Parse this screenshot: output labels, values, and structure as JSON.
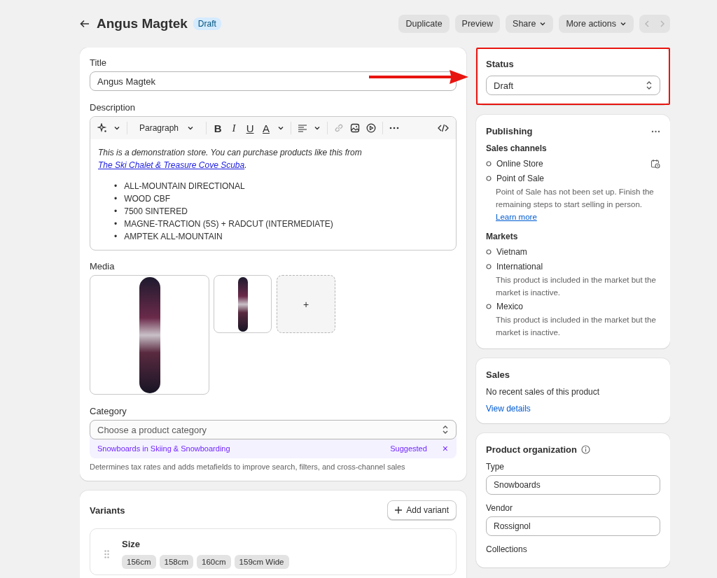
{
  "header": {
    "title": "Angus Magtek",
    "badge": "Draft",
    "actions": [
      {
        "label": "Duplicate",
        "dropdown": false
      },
      {
        "label": "Preview",
        "dropdown": false
      },
      {
        "label": "Share",
        "dropdown": true
      },
      {
        "label": "More actions",
        "dropdown": true
      }
    ],
    "pager": {
      "previous_disabled": true,
      "next_disabled": true
    }
  },
  "product": {
    "title_label": "Title",
    "title_value": "Angus Magtek",
    "description_label": "Description",
    "editor": {
      "block_style": "Paragraph",
      "format_buttons": [
        "B",
        "I",
        "U",
        "A"
      ]
    },
    "description": {
      "intro": "This is a demonstration store. You can purchase products like this from ",
      "link": "The Ski Chalet & Treasure Cove Scuba",
      "end": ".",
      "bullet": "•",
      "bullets": [
        "ALL-MOUNTAIN DIRECTIONAL",
        "WOOD CBF",
        "7500 SINTERED",
        "MAGNE-TRACTION (5S) + RADCUT (INTERMEDIATE)",
        "AMPTEK ALL-MOUNTAIN"
      ]
    },
    "media": {
      "label": "Media",
      "images": [
        {
          "kind": "large"
        },
        {
          "kind": "small"
        }
      ],
      "add_symbol": "+"
    },
    "category": {
      "label": "Category",
      "placeholder": "Choose a product category",
      "suggestion": "Snowboards in Skiing & Snowboarding",
      "suggestion_tag": "Suggested",
      "dismiss": "×",
      "help": "Determines tax rates and adds metafields to improve search, filters, and cross-channel sales"
    }
  },
  "variants": {
    "title": "Variants",
    "add_button": "Add variant",
    "options": [
      {
        "name": "Size",
        "values": [
          "156cm",
          "158cm",
          "160cm",
          "159cm Wide"
        ]
      }
    ]
  },
  "status": {
    "label": "Status",
    "value": "Draft",
    "highlighted": true
  },
  "publishing": {
    "title": "Publishing",
    "sales_channels_label": "Sales channels",
    "channels": [
      {
        "name": "Online Store",
        "schedule": true
      },
      {
        "name": "Point of Sale",
        "schedule": false,
        "note": "Point of Sale has not been set up. Finish the remaining steps to start selling in person.",
        "link": "Learn more"
      }
    ],
    "markets_label": "Markets",
    "markets": [
      {
        "name": "Vietnam"
      },
      {
        "name": "International",
        "note": "This product is included in the market but the market is inactive."
      },
      {
        "name": "Mexico",
        "note": "This product is included in the market but the market is inactive."
      }
    ]
  },
  "sales": {
    "title": "Sales",
    "text": "No recent sales of this product",
    "link": "View details"
  },
  "organization": {
    "title": "Product organization",
    "type_label": "Type",
    "type_value": "Snowboards",
    "vendor_label": "Vendor",
    "vendor_value": "Rossignol",
    "collections_label": "Collections"
  }
}
